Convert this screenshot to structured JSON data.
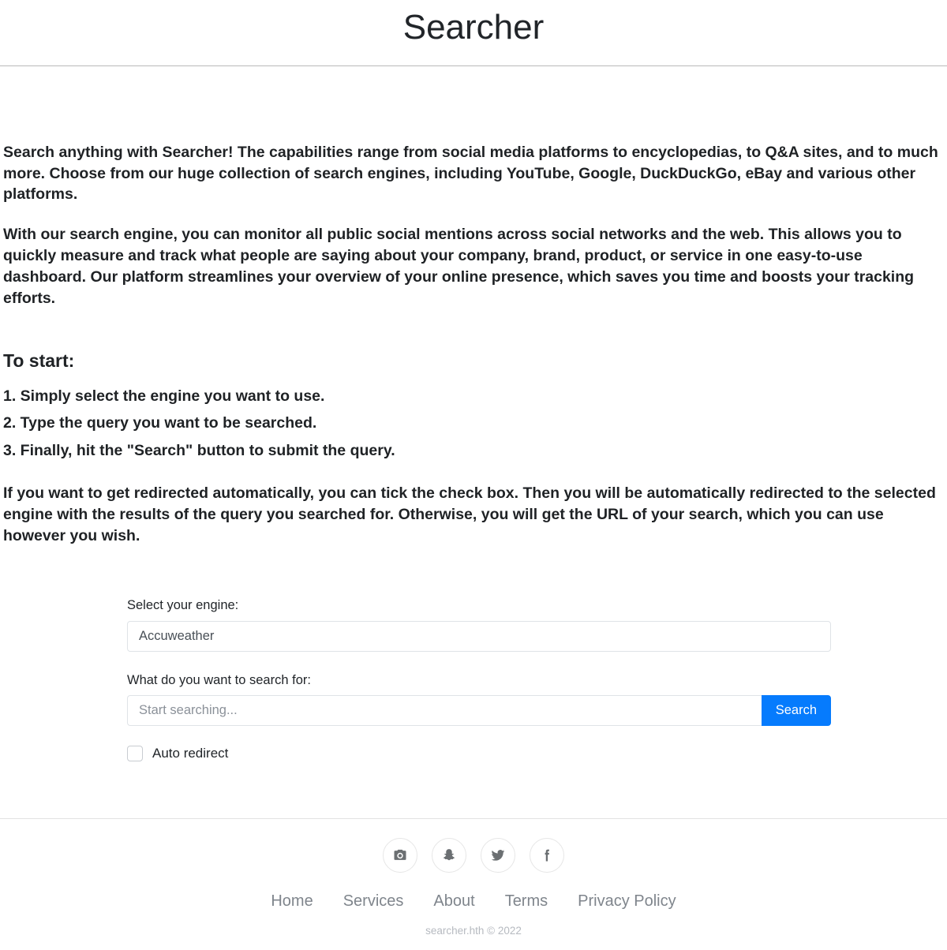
{
  "header": {
    "title": "Searcher"
  },
  "intro": {
    "paragraph_1": "Search anything with Searcher! The capabilities range from social media platforms to encyclopedias, to Q&A sites, and to much more. Choose from our huge collection of search engines, including YouTube, Google, DuckDuckGo, eBay and various other platforms.",
    "paragraph_2": "With our search engine, you can monitor all public social mentions across social networks and the web. This allows you to quickly measure and track what people are saying about your company, brand, product, or service in one easy-to-use dashboard. Our platform streamlines your overview of your online presence, which saves you time and boosts your tracking efforts."
  },
  "instructions": {
    "heading": "To start:",
    "steps": [
      "1. Simply select the engine you want to use.",
      "2. Type the query you want to be searched.",
      "3. Finally, hit the \"Search\" button to submit the query."
    ],
    "note": "If you want to get redirected automatically, you can tick the check box. Then you will be automatically redirected to the selected engine with the results of the query you searched for. Otherwise, you will get the URL of your search, which you can use however you wish."
  },
  "form": {
    "engine_label": "Select your engine:",
    "engine_selected": "Accuweather",
    "engine_options": [
      "Accuweather"
    ],
    "query_label": "What do you want to search for:",
    "query_value": "",
    "query_placeholder": "Start searching...",
    "search_button": "Search",
    "auto_redirect_label": "Auto redirect",
    "auto_redirect_checked": false,
    "accent_color": "#067bfd"
  },
  "footer": {
    "social": [
      {
        "name": "instagram-icon",
        "label": "Instagram"
      },
      {
        "name": "snapchat-icon",
        "label": "Snapchat"
      },
      {
        "name": "twitter-icon",
        "label": "Twitter"
      },
      {
        "name": "facebook-icon",
        "label": "Facebook"
      }
    ],
    "links": [
      "Home",
      "Services",
      "About",
      "Terms",
      "Privacy Policy"
    ],
    "copyright": "searcher.hth © 2022"
  }
}
